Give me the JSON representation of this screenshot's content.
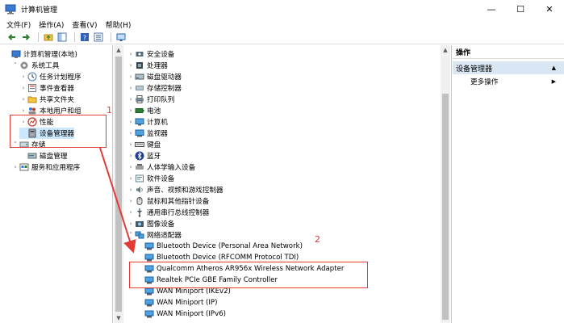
{
  "window": {
    "title": "计算机管理",
    "controls": {
      "minimize": "—",
      "maximize": "☐",
      "close": "✕"
    }
  },
  "menu": [
    "文件(F)",
    "操作(A)",
    "查看(V)",
    "帮助(H)"
  ],
  "left_tree": [
    {
      "label": "计算机管理(本地)",
      "indent": 0,
      "arrow": "",
      "icon": "computer-mgmt-icon"
    },
    {
      "label": "系统工具",
      "indent": 1,
      "arrow": "˅",
      "icon": "tools-icon"
    },
    {
      "label": "任务计划程序",
      "indent": 2,
      "arrow": "›",
      "icon": "clock-icon"
    },
    {
      "label": "事件查看器",
      "indent": 2,
      "arrow": "›",
      "icon": "event-icon"
    },
    {
      "label": "共享文件夹",
      "indent": 2,
      "arrow": "›",
      "icon": "folder-icon"
    },
    {
      "label": "本地用户和组",
      "indent": 2,
      "arrow": "›",
      "icon": "users-icon"
    },
    {
      "label": "性能",
      "indent": 2,
      "arrow": "›",
      "icon": "performance-icon"
    },
    {
      "label": "设备管理器",
      "indent": 2,
      "arrow": "",
      "icon": "device-manager-icon",
      "selected": true
    },
    {
      "label": "存储",
      "indent": 1,
      "arrow": "˅",
      "icon": "storage-icon"
    },
    {
      "label": "磁盘管理",
      "indent": 2,
      "arrow": "",
      "icon": "disk-icon"
    },
    {
      "label": "服务和应用程序",
      "indent": 1,
      "arrow": "›",
      "icon": "services-icon"
    }
  ],
  "device_tree": [
    {
      "label": "安全设备",
      "indent": 0,
      "arrow": "›",
      "icon": "security-icon"
    },
    {
      "label": "处理器",
      "indent": 0,
      "arrow": "›",
      "icon": "cpu-icon"
    },
    {
      "label": "磁盘驱动器",
      "indent": 0,
      "arrow": "›",
      "icon": "disk-drive-icon"
    },
    {
      "label": "存储控制器",
      "indent": 0,
      "arrow": "›",
      "icon": "storage-controller-icon"
    },
    {
      "label": "打印队列",
      "indent": 0,
      "arrow": "›",
      "icon": "printer-icon"
    },
    {
      "label": "电池",
      "indent": 0,
      "arrow": "›",
      "icon": "battery-icon"
    },
    {
      "label": "计算机",
      "indent": 0,
      "arrow": "›",
      "icon": "computer-icon"
    },
    {
      "label": "监视器",
      "indent": 0,
      "arrow": "›",
      "icon": "monitor-icon"
    },
    {
      "label": "键盘",
      "indent": 0,
      "arrow": "›",
      "icon": "keyboard-icon"
    },
    {
      "label": "蓝牙",
      "indent": 0,
      "arrow": "›",
      "icon": "bluetooth-icon"
    },
    {
      "label": "人体学输入设备",
      "indent": 0,
      "arrow": "›",
      "icon": "hid-icon"
    },
    {
      "label": "软件设备",
      "indent": 0,
      "arrow": "›",
      "icon": "software-device-icon"
    },
    {
      "label": "声音、视频和游戏控制器",
      "indent": 0,
      "arrow": "›",
      "icon": "sound-icon"
    },
    {
      "label": "鼠标和其他指针设备",
      "indent": 0,
      "arrow": "›",
      "icon": "mouse-icon"
    },
    {
      "label": "通用串行总线控制器",
      "indent": 0,
      "arrow": "›",
      "icon": "usb-icon"
    },
    {
      "label": "图像设备",
      "indent": 0,
      "arrow": "›",
      "icon": "camera-icon"
    },
    {
      "label": "网络适配器",
      "indent": 0,
      "arrow": "˅",
      "icon": "network-icon"
    },
    {
      "label": "Bluetooth Device (Personal Area Network)",
      "indent": 1,
      "arrow": "",
      "icon": "network-adapter-icon"
    },
    {
      "label": "Bluetooth Device (RFCOMM Protocol TDI)",
      "indent": 1,
      "arrow": "",
      "icon": "network-adapter-icon"
    },
    {
      "label": "Qualcomm Atheros AR956x Wireless Network Adapter",
      "indent": 1,
      "arrow": "",
      "icon": "network-adapter-icon"
    },
    {
      "label": "Realtek PCIe GBE Family Controller",
      "indent": 1,
      "arrow": "",
      "icon": "network-adapter-icon"
    },
    {
      "label": "WAN Miniport (IKEv2)",
      "indent": 1,
      "arrow": "",
      "icon": "network-adapter-icon"
    },
    {
      "label": "WAN Miniport (IP)",
      "indent": 1,
      "arrow": "",
      "icon": "network-adapter-icon"
    },
    {
      "label": "WAN Miniport (IPv6)",
      "indent": 1,
      "arrow": "",
      "icon": "network-adapter-icon"
    }
  ],
  "actions": {
    "header": "操作",
    "group": "设备管理器",
    "more": "更多操作"
  },
  "annotations": {
    "n1": "1",
    "n2": "2"
  },
  "colors": {
    "selection": "#cce8ff",
    "annotation": "#e53935",
    "action_group": "#d9e7f5"
  }
}
